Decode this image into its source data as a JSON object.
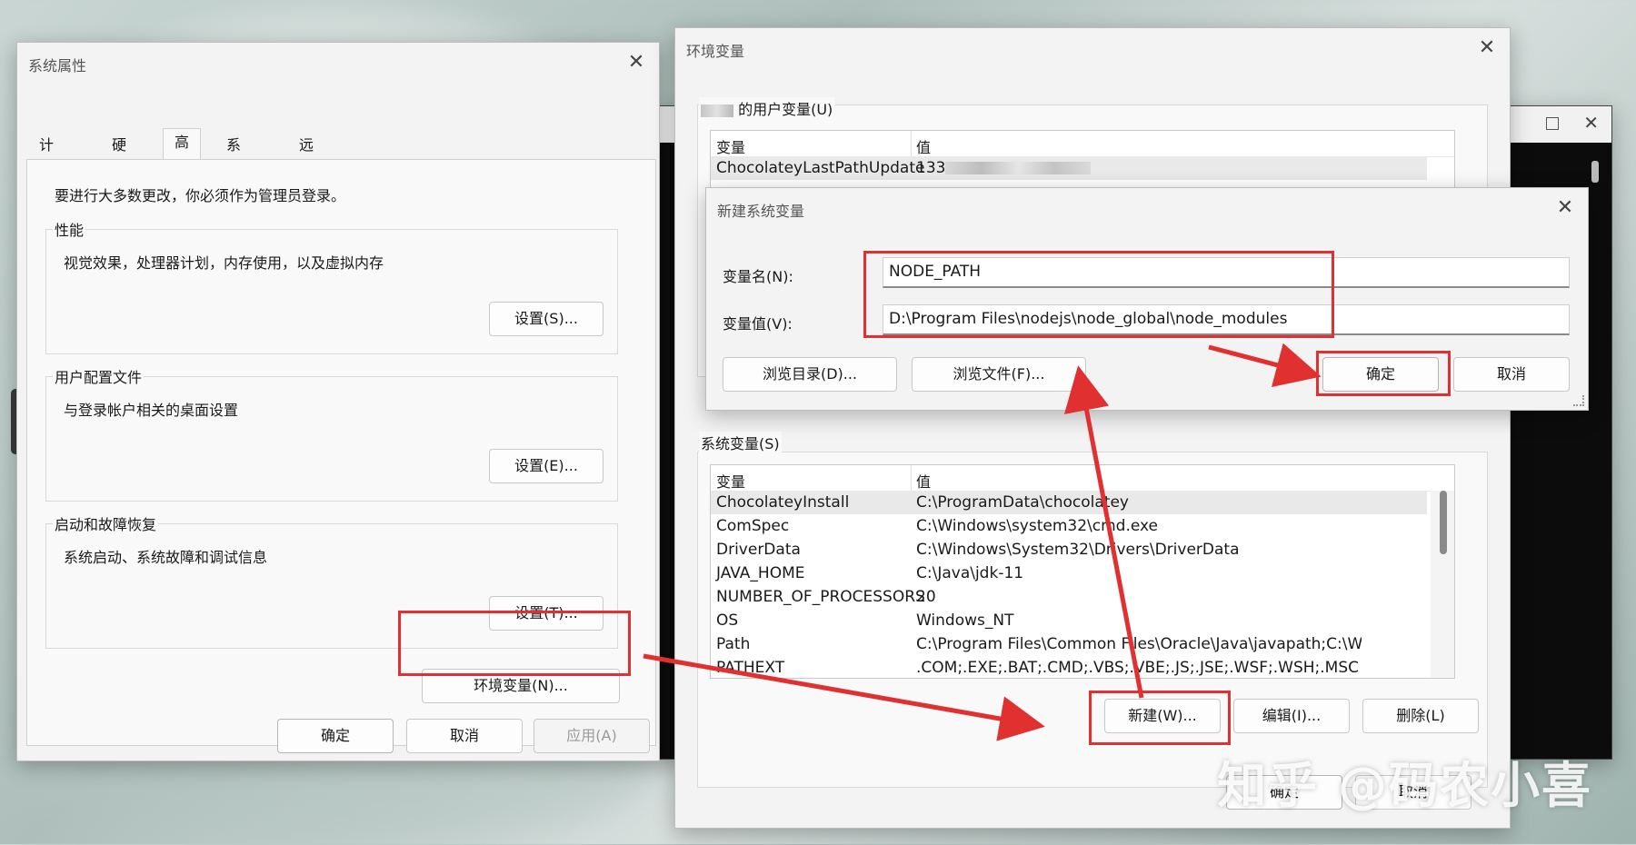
{
  "sys_props": {
    "title": "系统属性",
    "tabs": [
      "计算机名",
      "硬件",
      "高级",
      "系统保护",
      "远程"
    ],
    "admin_note": "要进行大多数更改，你必须作为管理员登录。",
    "performance": {
      "label": "性能",
      "desc": "视觉效果，处理器计划，内存使用，以及虚拟内存",
      "button": "设置(S)..."
    },
    "profiles": {
      "label": "用户配置文件",
      "desc": "与登录帐户相关的桌面设置",
      "button": "设置(E)..."
    },
    "startup": {
      "label": "启动和故障恢复",
      "desc": "系统启动、系统故障和调试信息",
      "button": "设置(T)..."
    },
    "env_button": "环境变量(N)...",
    "ok": "确定",
    "cancel": "取消",
    "apply": "应用(A)"
  },
  "env_vars": {
    "title": "环境变量",
    "user_section": "的用户变量(U)",
    "col_var": "变量",
    "col_val": "值",
    "user_rows": [
      {
        "name": "ChocolateyLastPathUpdate",
        "value": "133"
      }
    ],
    "sys_section": "系统变量(S)",
    "sys_rows": [
      {
        "name": "ChocolateyInstall",
        "value": "C:\\ProgramData\\chocolatey"
      },
      {
        "name": "ComSpec",
        "value": "C:\\Windows\\system32\\cmd.exe"
      },
      {
        "name": "DriverData",
        "value": "C:\\Windows\\System32\\Drivers\\DriverData"
      },
      {
        "name": "JAVA_HOME",
        "value": "C:\\Java\\jdk-11"
      },
      {
        "name": "NUMBER_OF_PROCESSORS",
        "value": "20"
      },
      {
        "name": "OS",
        "value": "Windows_NT"
      },
      {
        "name": "Path",
        "value": "C:\\Program Files\\Common Files\\Oracle\\Java\\javapath;C:\\Windows\\..."
      },
      {
        "name": "PATHEXT",
        "value": ".COM;.EXE;.BAT;.CMD;.VBS;.VBE;.JS;.JSE;.WSF;.WSH;.MSC"
      }
    ],
    "new_btn": "新建(W)...",
    "edit_btn": "编辑(I)...",
    "delete_btn": "删除(L)",
    "ok": "确定",
    "cancel": "取消"
  },
  "new_var": {
    "title": "新建系统变量",
    "name_label": "变量名(N):",
    "name_value": "NODE_PATH",
    "value_label": "变量值(V):",
    "value_value": "D:\\Program Files\\nodejs\\node_global\\node_modules",
    "browse_dir": "浏览目录(D)...",
    "browse_file": "浏览文件(F)...",
    "ok": "确定",
    "cancel": "取消"
  },
  "watermark": "知乎 @码农小喜",
  "colors": {
    "annotation_red": "#e03030",
    "window_bg": "#f3f3f3"
  }
}
